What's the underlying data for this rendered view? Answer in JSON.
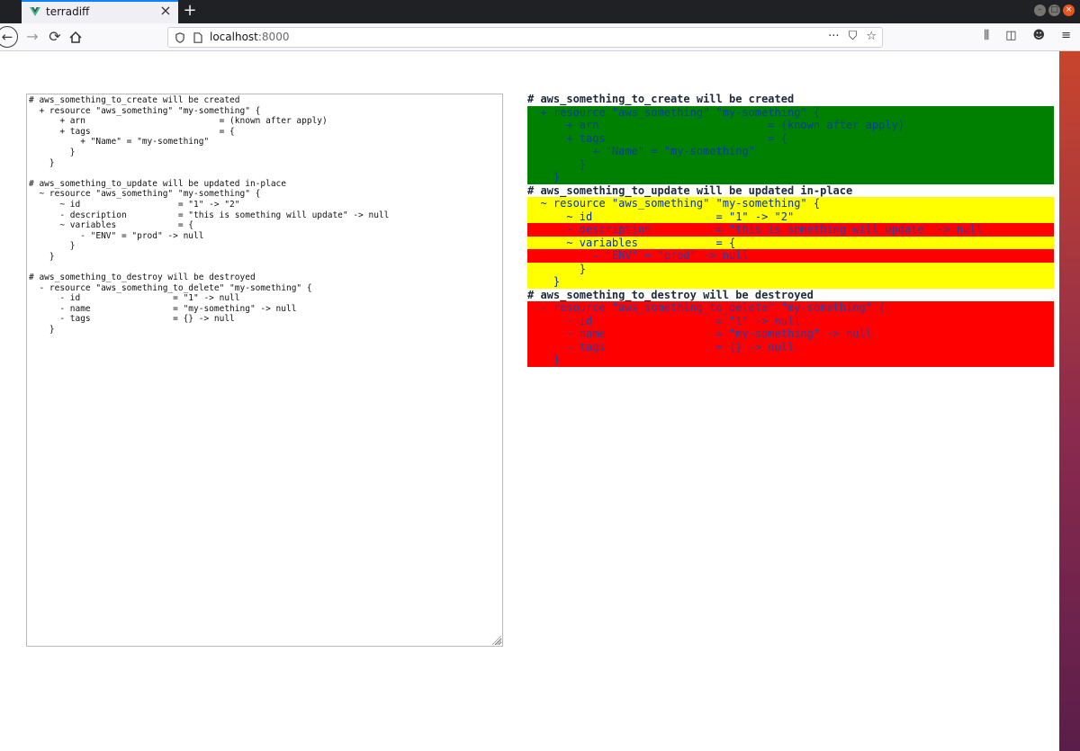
{
  "browser": {
    "tab_title": "terradiff",
    "url_host": "localhost",
    "url_port": ":8000"
  },
  "icons": {
    "tab_favicon": "vue-logo-icon",
    "tab_close": "close-icon",
    "new_tab": "plus-icon",
    "back": "back-arrow-icon",
    "forward": "forward-arrow-icon",
    "reload": "reload-icon",
    "home": "home-icon",
    "tracking": "shield-icon",
    "page": "page-icon",
    "more": "more-icon",
    "pocket": "pocket-icon",
    "bookmark": "star-icon",
    "library": "library-icon",
    "sidebar": "sidebar-icon",
    "account": "account-icon",
    "menu": "hamburger-menu-icon"
  },
  "colors": {
    "create": "#008000",
    "update": "#ffff00",
    "remove": "#ff0000",
    "tab_accent": "#0a84ff"
  },
  "input_plan": "# aws_something_to_create will be created\n  + resource \"aws_something\" \"my-something\" {\n      + arn                          = (known after apply)\n      + tags                         = {\n          + \"Name\" = \"my-something\"\n        }\n    }\n\n# aws_something_to_update will be updated in-place\n  ~ resource \"aws_something\" \"my-something\" {\n      ~ id                   = \"1\" -> \"2\"\n      - description          = \"this is something will update\" -> null\n      ~ variables            = {\n          - \"ENV\" = \"prod\" -> null\n        }\n    }\n\n# aws_something_to_destroy will be destroyed\n  - resource \"aws_something_to_delete\" \"my-something\" {\n      - id                  = \"1\" -> null\n      - name                = \"my-something\" -> null\n      - tags                = {} -> null\n    }",
  "diff_lines": [
    {
      "kind": "header",
      "text": "# aws_something_to_create will be created"
    },
    {
      "kind": "create",
      "text": "  + resource \"aws_something\" \"my-something\" {"
    },
    {
      "kind": "create",
      "text": "      + arn                          = (known after apply)"
    },
    {
      "kind": "create",
      "text": "      + tags                         = {"
    },
    {
      "kind": "create",
      "text": "          + \"Name\" = \"my-something\""
    },
    {
      "kind": "create",
      "text": "        }"
    },
    {
      "kind": "create",
      "text": "    }"
    },
    {
      "kind": "header",
      "text": "# aws_something_to_update will be updated in-place"
    },
    {
      "kind": "update",
      "text": "  ~ resource \"aws_something\" \"my-something\" {"
    },
    {
      "kind": "update",
      "text": "      ~ id                   = \"1\" -> \"2\""
    },
    {
      "kind": "remove",
      "text": "      - description          = \"this is something will update\" -> null"
    },
    {
      "kind": "update",
      "text": "      ~ variables            = {"
    },
    {
      "kind": "remove",
      "text": "          - \"ENV\" = \"prod\" -> null"
    },
    {
      "kind": "update",
      "text": "        }"
    },
    {
      "kind": "update",
      "text": "    }"
    },
    {
      "kind": "header",
      "text": "# aws_something_to_destroy will be destroyed"
    },
    {
      "kind": "remove",
      "text": "  - resource \"aws_something_to_delete\" \"my-something\" {"
    },
    {
      "kind": "remove",
      "text": "      - id                   = \"1\" -> null"
    },
    {
      "kind": "remove",
      "text": "      - name                 = \"my-something\" -> null"
    },
    {
      "kind": "remove",
      "text": "      - tags                 = {} -> null"
    },
    {
      "kind": "remove",
      "text": "    }"
    }
  ]
}
